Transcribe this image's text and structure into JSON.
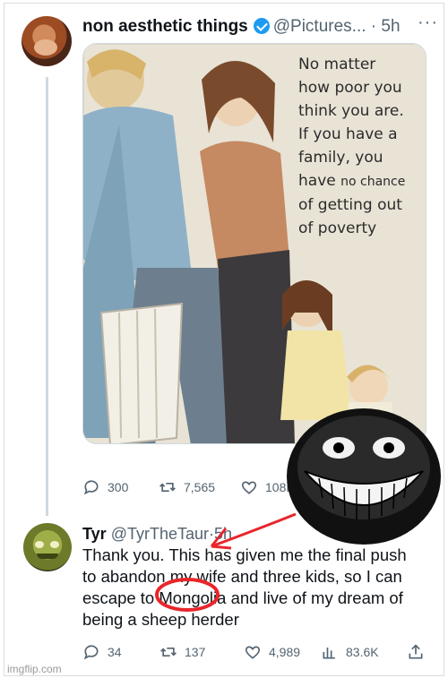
{
  "tweet": {
    "name": "non aesthetic things",
    "handle": "@Pictures...",
    "separator": "·",
    "time": "5h",
    "more": "···",
    "image_caption": {
      "line1": "No matter",
      "line2": "how poor you",
      "line3": "think you are.",
      "line4": "If you have a",
      "line5": "family, you",
      "line6a": "have",
      "line6b": "no chance",
      "line7": "of getting out",
      "line8": "of poverty"
    },
    "stats": {
      "replies": "300",
      "retweets": "7,565",
      "likes": "108K"
    }
  },
  "reply": {
    "name": "Tyr",
    "handle": "@TyrTheTaur",
    "separator": "·",
    "time": "5h",
    "line1": "Thank you. This has given me the final push",
    "line2": "to abandon my wife and three kids, so I can",
    "line3": "escape to Mongolia and live of my dream of",
    "line4": "being a sheep herder",
    "stats": {
      "replies": "34",
      "retweets": "137",
      "likes": "4,989",
      "views": "83.6K"
    }
  },
  "watermark": "imgflip.com",
  "colors": {
    "verified": "#1d9bf0",
    "annotation_red": "#e8262b",
    "muted": "#536471"
  },
  "icons": [
    "verified-badge-icon",
    "reply-icon",
    "retweet-icon",
    "like-icon",
    "views-icon",
    "share-icon",
    "troll-face-icon",
    "red-arrow-icon",
    "red-circle-icon"
  ]
}
